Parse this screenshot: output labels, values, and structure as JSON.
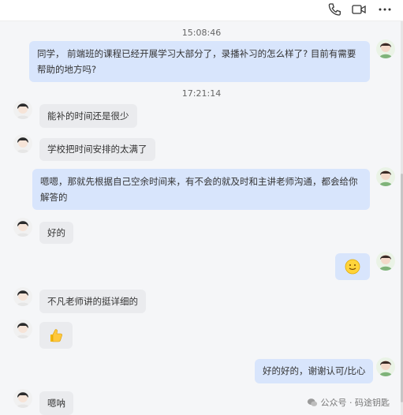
{
  "header": {
    "phone_icon": "phone-icon",
    "video_icon": "video-icon",
    "more_icon": "more-icon"
  },
  "messages": [
    {
      "type": "time",
      "text": "15:08:46"
    },
    {
      "type": "out",
      "text": "同学， 前端班的课程已经开展学习大部分了，录播补习的怎么样了? 目前有需要帮助的地方吗?"
    },
    {
      "type": "time",
      "text": "17:21:14"
    },
    {
      "type": "in",
      "text": "能补的时间还是很少"
    },
    {
      "type": "in",
      "text": "学校把时间安排的太满了"
    },
    {
      "type": "out",
      "text": "嗯嗯，那就先根据自己空余时间来，有不会的就及时和主讲老师沟通，都会给你解答的"
    },
    {
      "type": "in",
      "text": "好的"
    },
    {
      "type": "out",
      "emoji": "smile"
    },
    {
      "type": "in",
      "text": "不凡老师讲的挺详细的"
    },
    {
      "type": "in",
      "emoji": "thumbs-up"
    },
    {
      "type": "out",
      "text": "好的好的，谢谢认可/比心"
    },
    {
      "type": "in",
      "text": "嗯呐"
    }
  ],
  "watermark": {
    "text": "公众号 · 码途钥匙"
  }
}
